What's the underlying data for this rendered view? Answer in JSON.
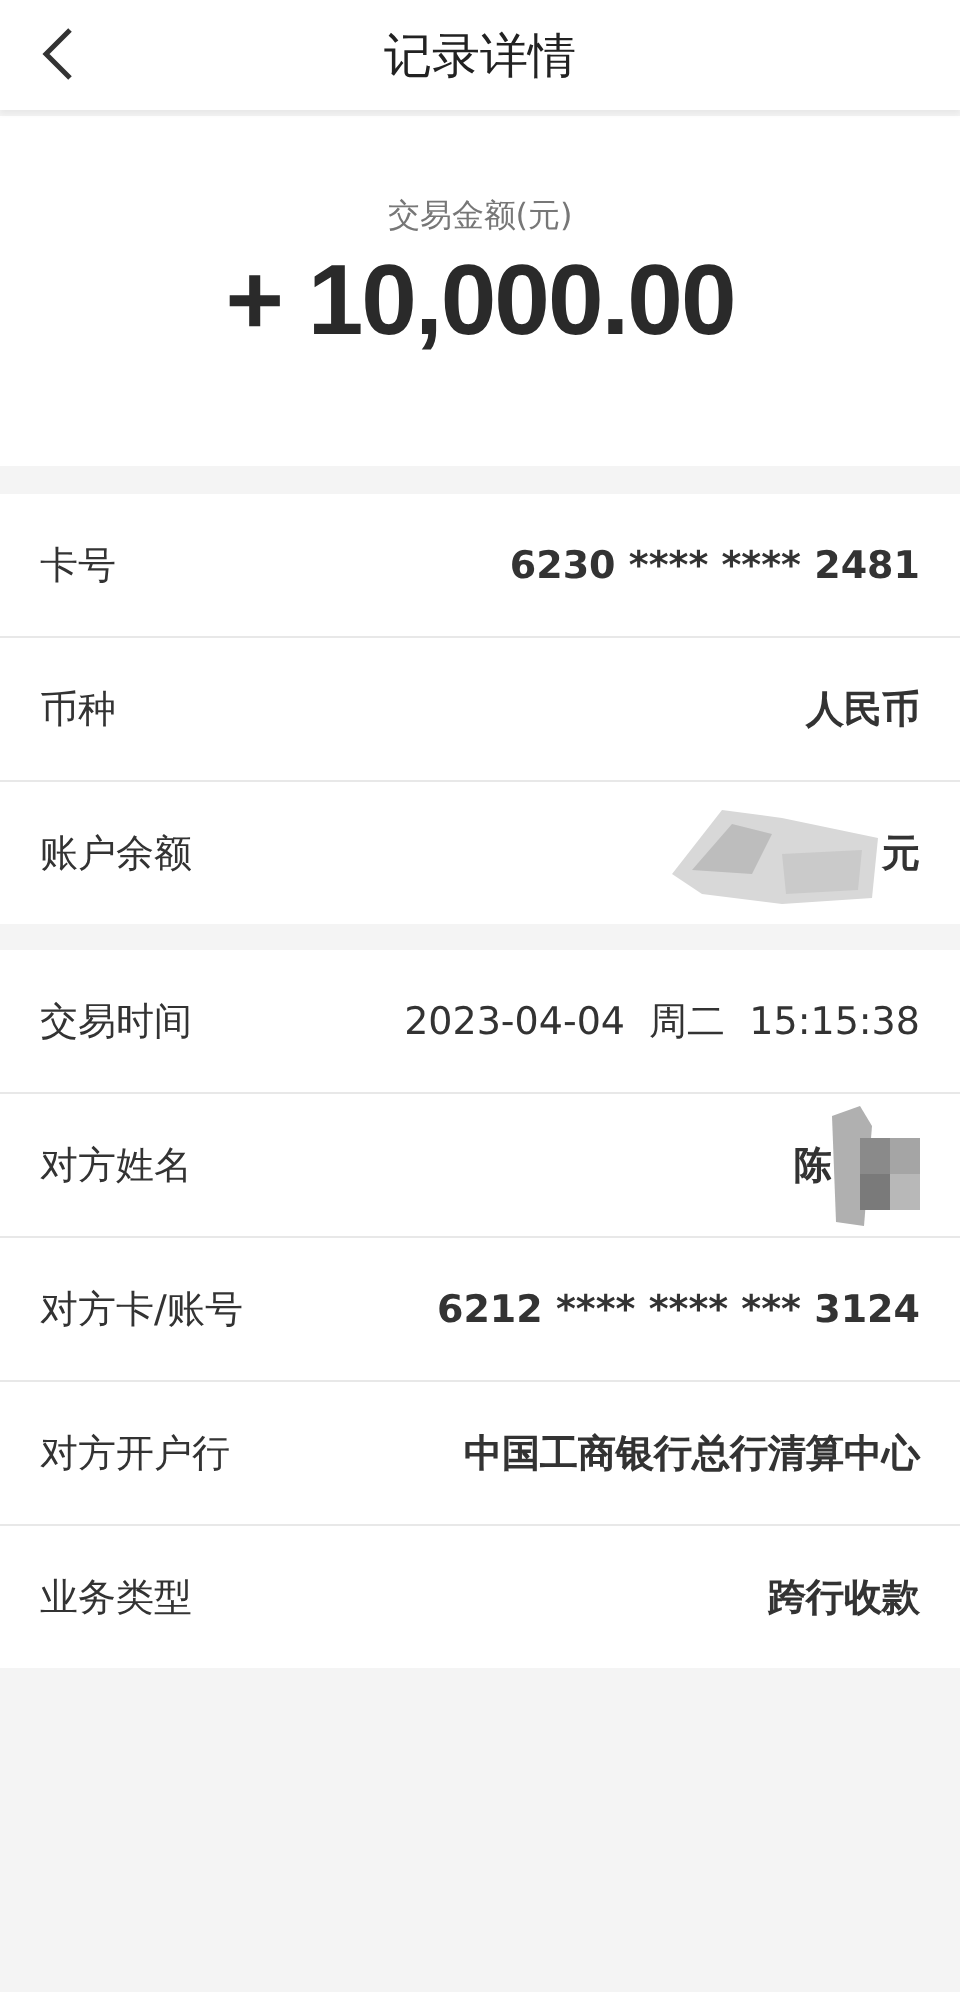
{
  "header": {
    "title": "记录详情"
  },
  "amount": {
    "label": "交易金额(元)",
    "value": "+ 10,000.00"
  },
  "sections": [
    {
      "rows": [
        {
          "label": "卡号",
          "value": "6230 **** **** 2481",
          "kind": "bold"
        },
        {
          "label": "币种",
          "value": "人民币",
          "kind": "bold"
        },
        {
          "label": "账户余额",
          "value": "元",
          "kind": "smudged"
        }
      ]
    },
    {
      "rows": [
        {
          "label": "交易时间",
          "value": "2023-04-04  周二  15:15:38",
          "kind": "plain"
        },
        {
          "label": "对方姓名",
          "value": "陈",
          "kind": "mosaic"
        },
        {
          "label": "对方卡/账号",
          "value": "6212 **** **** *** 3124",
          "kind": "bold"
        },
        {
          "label": "对方开户行",
          "value": "中国工商银行总行清算中心",
          "kind": "bold"
        },
        {
          "label": "业务类型",
          "value": "跨行收款",
          "kind": "bold"
        }
      ]
    }
  ]
}
